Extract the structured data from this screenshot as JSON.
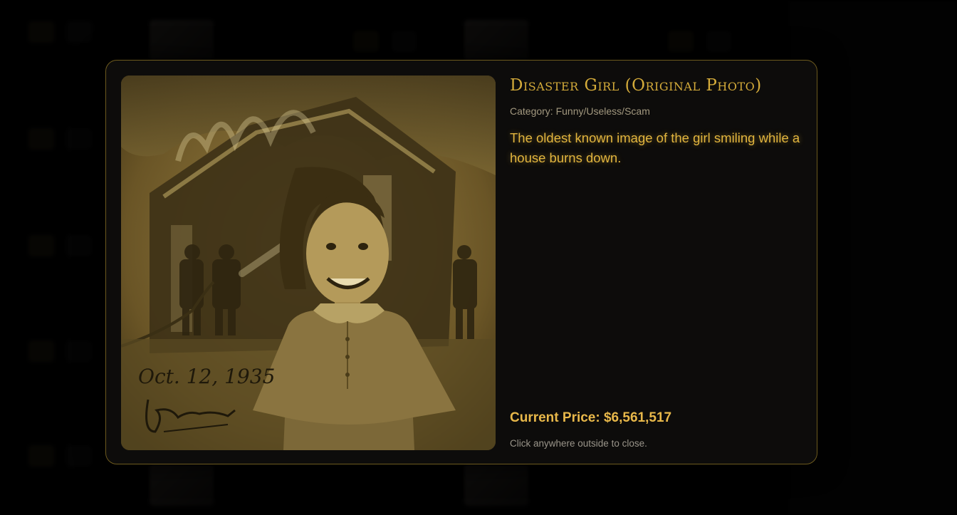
{
  "modal": {
    "title": "Disaster Girl (Original Photo)",
    "category_label": "Category:",
    "category": "Funny/Useless/Scam",
    "description": "The oldest known image of the girl smiling while a house burns down.",
    "price_label": "Current Price:",
    "price": "$6,561,517",
    "close_hint": "Click anywhere outside to close.",
    "photo": {
      "icon": "sepia-photo-girl-burning-house",
      "handwritten_date": "Oct. 12, 1935"
    }
  },
  "background": {
    "side_title": "",
    "cards": [
      {
        "title": "",
        "buy": "",
        "sell": ""
      },
      {
        "title": "",
        "buy": "",
        "sell": ""
      }
    ]
  },
  "colors": {
    "accent": "#d4ab3a",
    "border": "#6d5a1e",
    "modal_bg": "#0d0c0b",
    "category_text": "#a2987f",
    "hint_text": "#9a958a"
  }
}
